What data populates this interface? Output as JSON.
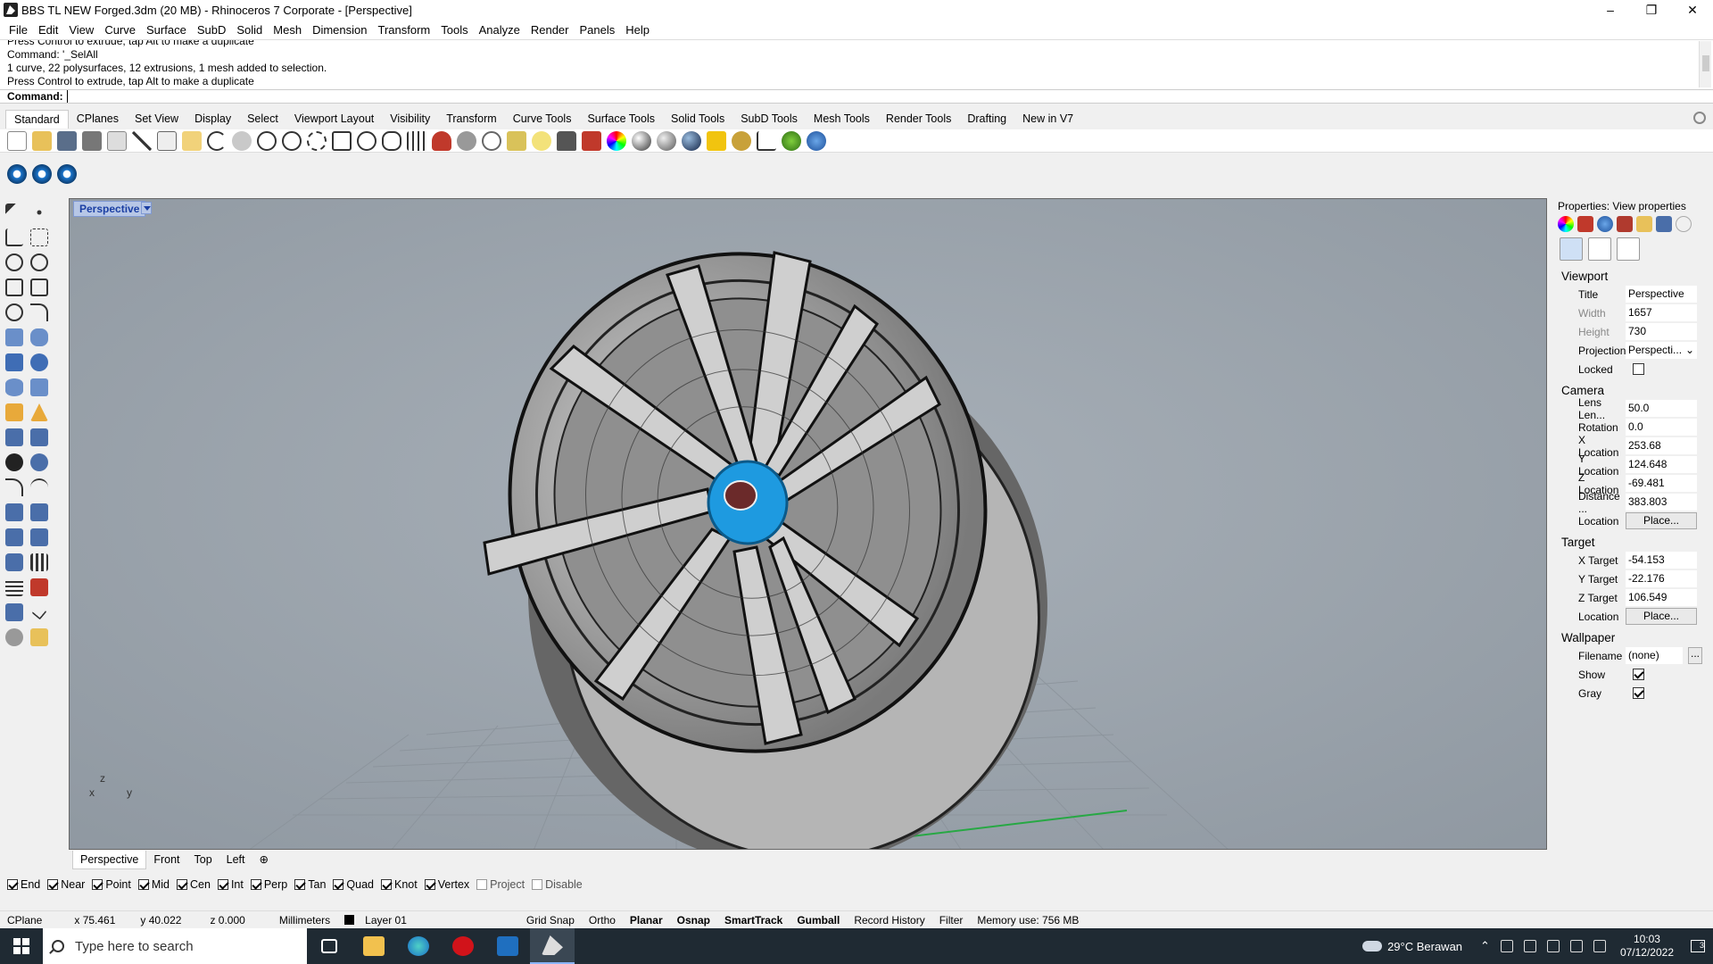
{
  "window": {
    "title": "BBS TL NEW Forged.3dm (20 MB) - Rhinoceros 7 Corporate - [Perspective]",
    "minimize": "–",
    "restore": "❐",
    "close": "✕"
  },
  "menu": [
    "File",
    "Edit",
    "View",
    "Curve",
    "Surface",
    "SubD",
    "Solid",
    "Mesh",
    "Dimension",
    "Transform",
    "Tools",
    "Analyze",
    "Render",
    "Panels",
    "Help"
  ],
  "command_history": [
    "Press Control to extrude, tap Alt to make a duplicate",
    "Command: '_SelAll",
    "1 curve, 22 polysurfaces, 12 extrusions, 1 mesh added to selection.",
    "Press Control to extrude, tap Alt to make a duplicate"
  ],
  "command_prompt": "Command:",
  "toolbar_tabs": [
    "Standard",
    "CPlanes",
    "Set View",
    "Display",
    "Select",
    "Viewport Layout",
    "Visibility",
    "Transform",
    "Curve Tools",
    "Surface Tools",
    "Solid Tools",
    "SubD Tools",
    "Mesh Tools",
    "Render Tools",
    "Drafting",
    "New in V7"
  ],
  "viewport": {
    "label": "Perspective",
    "axis_z": "z",
    "axis_x": "x",
    "axis_y": "y",
    "wheel_color": "#1e9ae0",
    "grid_x_color": "#c0392b",
    "grid_y_color": "#27a844"
  },
  "viewport_tabs": [
    "Perspective",
    "Front",
    "Top",
    "Left",
    "⊕"
  ],
  "osnaps": [
    {
      "label": "End",
      "on": true
    },
    {
      "label": "Near",
      "on": true
    },
    {
      "label": "Point",
      "on": true
    },
    {
      "label": "Mid",
      "on": true
    },
    {
      "label": "Cen",
      "on": true
    },
    {
      "label": "Int",
      "on": true
    },
    {
      "label": "Perp",
      "on": true
    },
    {
      "label": "Tan",
      "on": true
    },
    {
      "label": "Quad",
      "on": true
    },
    {
      "label": "Knot",
      "on": true
    },
    {
      "label": "Vertex",
      "on": true
    },
    {
      "label": "Project",
      "on": false
    },
    {
      "label": "Disable",
      "on": false
    }
  ],
  "status": {
    "cplane": "CPlane",
    "x": "x 75.461",
    "y": "y 40.022",
    "z": "z 0.000",
    "units": "Millimeters",
    "layer": "Layer 01",
    "grid_snap": "Grid Snap",
    "ortho": "Ortho",
    "planar": "Planar",
    "osnap": "Osnap",
    "smarttrack": "SmartTrack",
    "gumball": "Gumball",
    "record_history": "Record History",
    "filter": "Filter",
    "memory": "Memory use: 756 MB"
  },
  "panel": {
    "title": "Properties: View properties",
    "viewport_section": "Viewport",
    "camera_section": "Camera",
    "target_section": "Target",
    "wallpaper_section": "Wallpaper",
    "viewport": [
      {
        "k": "Title",
        "v": "Perspective"
      },
      {
        "k": "Width",
        "v": "1657"
      },
      {
        "k": "Height",
        "v": "730"
      },
      {
        "k": "Projection",
        "v": "Perspecti..."
      }
    ],
    "locked_label": "Locked",
    "camera": [
      {
        "k": "Lens Len...",
        "v": "50.0"
      },
      {
        "k": "Rotation",
        "v": "0.0"
      },
      {
        "k": "X Location",
        "v": "253.68"
      },
      {
        "k": "Y Location",
        "v": "124.648"
      },
      {
        "k": "Z Location",
        "v": "-69.481"
      },
      {
        "k": "Distance ...",
        "v": "383.803"
      }
    ],
    "location_label": "Location",
    "place_button": "Place...",
    "target": [
      {
        "k": "X Target",
        "v": "-54.153"
      },
      {
        "k": "Y Target",
        "v": "-22.176"
      },
      {
        "k": "Z Target",
        "v": "106.549"
      }
    ],
    "filename_label": "Filename",
    "filename_value": "(none)",
    "browse_button": "...",
    "show_label": "Show",
    "gray_label": "Gray"
  },
  "taskbar": {
    "search_placeholder": "Type here to search",
    "weather": "29°C Berawan",
    "time": "10:03",
    "date": "07/12/2022",
    "notifications": "3"
  }
}
